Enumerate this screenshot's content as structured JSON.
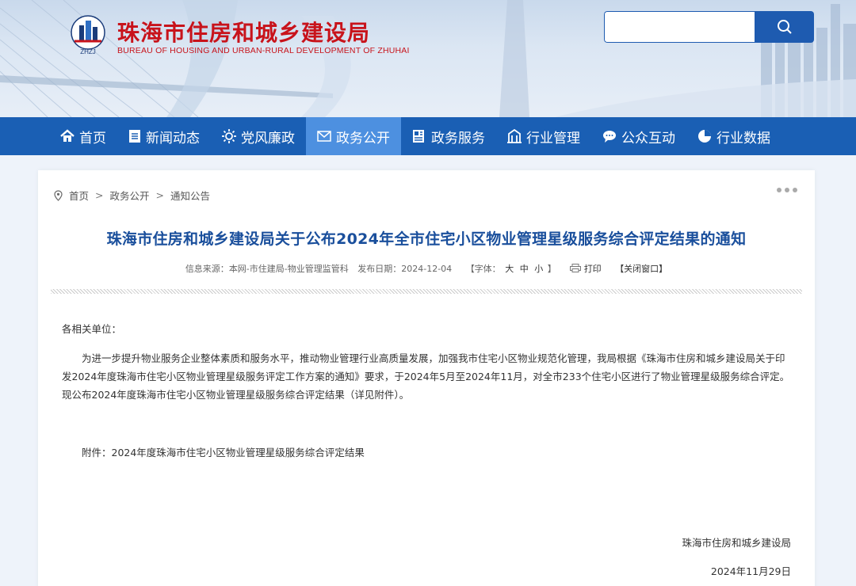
{
  "header": {
    "title_cn": "珠海市住房和城乡建设局",
    "title_en": "BUREAU OF HOUSING AND URBAN-RURAL DEVELOPMENT OF ZHUHAI",
    "logo_text": "ZHZJ",
    "search": {
      "placeholder": "",
      "value": ""
    }
  },
  "nav": {
    "items": [
      {
        "label": "首页",
        "icon": "home-icon"
      },
      {
        "label": "新闻动态",
        "icon": "document-icon"
      },
      {
        "label": "党风廉政",
        "icon": "sun-icon"
      },
      {
        "label": "政务公开",
        "icon": "mail-icon",
        "active": true
      },
      {
        "label": "政务服务",
        "icon": "news-icon"
      },
      {
        "label": "行业管理",
        "icon": "building-icon"
      },
      {
        "label": "公众互动",
        "icon": "chat-icon"
      },
      {
        "label": "行业数据",
        "icon": "pie-chart-icon"
      }
    ]
  },
  "breadcrumb": {
    "items": [
      "首页",
      "政务公开",
      "通知公告"
    ],
    "separator": ">"
  },
  "article": {
    "title": "珠海市住房和城乡建设局关于公布2024年全市住宅小区物业管理星级服务综合评定结果的通知",
    "meta": {
      "source_label": "信息来源：",
      "source": "本网-市住建局-物业管理监管科",
      "date_label": "发布日期：",
      "date": "2024-12-04",
      "font_label": "【字体：",
      "font_large": "大",
      "font_medium": "中",
      "font_small": "小",
      "font_close": "】",
      "print": "打印",
      "close_window": "【关闭窗口】"
    },
    "salutation": "各相关单位：",
    "paragraph": "为进一步提升物业服务企业整体素质和服务水平，推动物业管理行业高质量发展，加强我市住宅小区物业规范化管理，我局根据《珠海市住房和城乡建设局关于印发2024年度珠海市住宅小区物业管理星级服务评定工作方案的通知》要求，于2024年5月至2024年11月，对全市233个住宅小区进行了物业管理星级服务综合评定。现公布2024年度珠海市住宅小区物业管理星级服务综合评定结果（详见附件）。",
    "attachment": "附件：2024年度珠海市住宅小区物业管理星级服务综合评定结果",
    "signature": "珠海市住房和城乡建设局",
    "sign_date": "2024年11月29日"
  },
  "colors": {
    "brand_red": "#c8131b",
    "nav_blue": "#1a5fb4",
    "nav_active": "#4d90e0",
    "title_blue": "#1a4f9c"
  }
}
